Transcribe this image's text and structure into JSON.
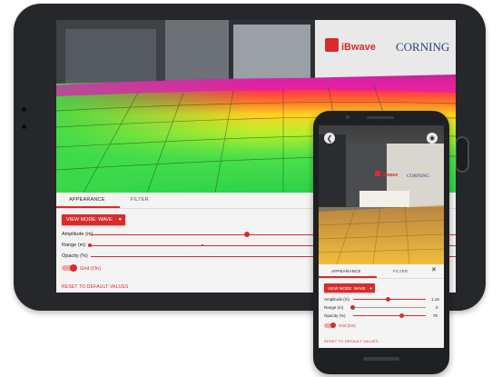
{
  "tablet": {
    "scene": {
      "logo_brand": "iBwave",
      "logo_partner": "CORNING"
    },
    "panel": {
      "tabs": [
        {
          "label": "APPEARANCE",
          "active": true
        },
        {
          "label": "FILTER",
          "active": false
        }
      ],
      "view_mode_label": "VIEW MODE: WAVE",
      "sliders": [
        {
          "label": "Amplitude (m)",
          "value": null
        },
        {
          "label": "Range (m)",
          "value": null
        },
        {
          "label": "Opacity (%)",
          "value": null
        }
      ],
      "grid_toggle_label": "Grid (On)",
      "grid_on": true,
      "reset_label": "RESET TO DEFAULT VALUES"
    }
  },
  "phone": {
    "scene": {
      "logo_brand": "iBwave",
      "logo_partner": "CORNING"
    },
    "panel": {
      "tabs": [
        {
          "label": "APPEARANCE",
          "active": true
        },
        {
          "label": "FILTER",
          "active": false
        }
      ],
      "close_glyph": "✕",
      "view_mode_label": "VIEW MODE: WAVE",
      "sliders": [
        {
          "label": "Amplitude (m)",
          "value": "1.18"
        },
        {
          "label": "Range (m)",
          "value": "0"
        },
        {
          "label": "Opacity (%)",
          "value": "70"
        }
      ],
      "grid_toggle_label": "Grid (On)",
      "grid_on": true,
      "reset_label": "RESET TO DEFAULT VALUES"
    }
  },
  "colors": {
    "accent": "#d82b2b",
    "device": "#26272a"
  },
  "icons": [
    "back-arrow-icon",
    "camera-icon",
    "close-icon",
    "dropdown-caret-icon"
  ]
}
